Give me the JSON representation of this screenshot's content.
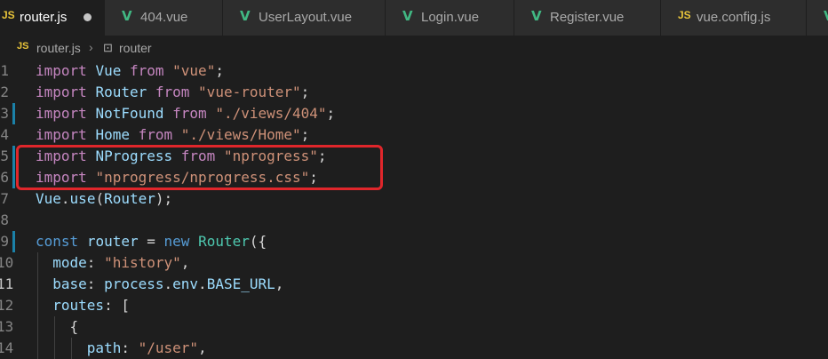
{
  "tabs": [
    {
      "icon": "JS",
      "label": "router.js",
      "active": true,
      "dirty": true
    },
    {
      "icon": "V",
      "label": "404.vue"
    },
    {
      "icon": "V",
      "label": "UserLayout.vue"
    },
    {
      "icon": "V",
      "label": "Login.vue"
    },
    {
      "icon": "V",
      "label": "Register.vue"
    },
    {
      "icon": "JS",
      "label": "vue.config.js"
    },
    {
      "icon": "V",
      "label": ""
    }
  ],
  "breadcrumb": {
    "file_icon": "JS",
    "file": "router.js",
    "separator": "›",
    "symbol_icon": "⊡",
    "symbol": "router"
  },
  "editor": {
    "lines": [
      {
        "number": "1",
        "tokens": [
          [
            "kw",
            "import"
          ],
          [
            "tx",
            " "
          ],
          [
            "id",
            "Vue"
          ],
          [
            "tx",
            " "
          ],
          [
            "kw",
            "from"
          ],
          [
            "tx",
            " "
          ],
          [
            "st",
            "\"vue\""
          ],
          [
            "tx",
            ";"
          ]
        ]
      },
      {
        "number": "2",
        "tokens": [
          [
            "kw",
            "import"
          ],
          [
            "tx",
            " "
          ],
          [
            "id",
            "Router"
          ],
          [
            "tx",
            " "
          ],
          [
            "kw",
            "from"
          ],
          [
            "tx",
            " "
          ],
          [
            "st",
            "\"vue-router\""
          ],
          [
            "tx",
            ";"
          ]
        ]
      },
      {
        "number": "3",
        "tokens": [
          [
            "kw",
            "import"
          ],
          [
            "tx",
            " "
          ],
          [
            "id",
            "NotFound"
          ],
          [
            "tx",
            " "
          ],
          [
            "kw",
            "from"
          ],
          [
            "tx",
            " "
          ],
          [
            "st",
            "\"./views/404\""
          ],
          [
            "tx",
            ";"
          ]
        ]
      },
      {
        "number": "4",
        "tokens": [
          [
            "kw",
            "import"
          ],
          [
            "tx",
            " "
          ],
          [
            "id",
            "Home"
          ],
          [
            "tx",
            " "
          ],
          [
            "kw",
            "from"
          ],
          [
            "tx",
            " "
          ],
          [
            "st",
            "\"./views/Home\""
          ],
          [
            "tx",
            ";"
          ]
        ]
      },
      {
        "number": "5",
        "tokens": [
          [
            "kw",
            "import"
          ],
          [
            "tx",
            " "
          ],
          [
            "id",
            "NProgress"
          ],
          [
            "tx",
            " "
          ],
          [
            "kw",
            "from"
          ],
          [
            "tx",
            " "
          ],
          [
            "st",
            "\"nprogress\""
          ],
          [
            "tx",
            ";"
          ]
        ]
      },
      {
        "number": "6",
        "tokens": [
          [
            "kw",
            "import"
          ],
          [
            "tx",
            " "
          ],
          [
            "st",
            "\"nprogress/nprogress.css\""
          ],
          [
            "tx",
            ";"
          ]
        ]
      },
      {
        "number": "7",
        "tokens": [
          [
            "id",
            "Vue"
          ],
          [
            "tx",
            "."
          ],
          [
            "id",
            "use"
          ],
          [
            "tx",
            "("
          ],
          [
            "id",
            "Router"
          ],
          [
            "tx",
            ");"
          ]
        ]
      },
      {
        "number": "8",
        "tokens": []
      },
      {
        "number": "9",
        "tokens": [
          [
            "kb",
            "const"
          ],
          [
            "tx",
            " "
          ],
          [
            "id",
            "router"
          ],
          [
            "tx",
            " = "
          ],
          [
            "kb",
            "new"
          ],
          [
            "tx",
            " "
          ],
          [
            "ty",
            "Router"
          ],
          [
            "tx",
            "({"
          ]
        ]
      },
      {
        "number": "10",
        "tokens": [
          [
            "tx",
            "  "
          ],
          [
            "id",
            "mode"
          ],
          [
            "tx",
            ": "
          ],
          [
            "st",
            "\"history\""
          ],
          [
            "tx",
            ","
          ]
        ]
      },
      {
        "number": "11",
        "tokens": [
          [
            "tx",
            "  "
          ],
          [
            "id",
            "base"
          ],
          [
            "tx",
            ": "
          ],
          [
            "id",
            "process"
          ],
          [
            "tx",
            "."
          ],
          [
            "id",
            "env"
          ],
          [
            "tx",
            "."
          ],
          [
            "id",
            "BASE_URL"
          ],
          [
            "tx",
            ","
          ]
        ]
      },
      {
        "number": "12",
        "tokens": [
          [
            "tx",
            "  "
          ],
          [
            "id",
            "routes"
          ],
          [
            "tx",
            ": ["
          ]
        ]
      },
      {
        "number": "13",
        "tokens": [
          [
            "tx",
            "    {"
          ]
        ]
      },
      {
        "number": "14",
        "tokens": [
          [
            "tx",
            "      "
          ],
          [
            "id",
            "path"
          ],
          [
            "tx",
            ": "
          ],
          [
            "st",
            "\"/user\""
          ],
          [
            "tx",
            ","
          ]
        ]
      }
    ]
  }
}
